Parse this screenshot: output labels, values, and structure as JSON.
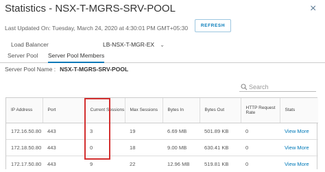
{
  "dialog": {
    "title": "Statistics - NSX-T-MGRS-SRV-POOL",
    "close_glyph": "×",
    "last_updated": "Last Updated On: Tuesday, March 24, 2020 at 4:30:01 PM GMT+05:30",
    "refresh_label": "REFRESH"
  },
  "load_balancer": {
    "label": "Load Balancer",
    "value": "LB-NSX-T-MGR-EX",
    "chevron": "⌄"
  },
  "tabs": [
    {
      "label": "Server Pool",
      "active": false
    },
    {
      "label": "Server Pool Members",
      "active": true
    }
  ],
  "server_pool": {
    "label": "Server Pool Name :",
    "value": "NSX-T-MGRS-SRV-POOL"
  },
  "search": {
    "placeholder": "Search"
  },
  "table": {
    "headers": [
      "IP Address",
      "Port",
      "Current Sessions",
      "Max Sessions",
      "Bytes In",
      "Bytes Out",
      "HTTP Request Rate",
      "Stats"
    ],
    "rows": [
      [
        "172.16.50.80",
        "443",
        "3",
        "19",
        "6.69 MB",
        "501.89 KB",
        "0",
        "View More"
      ],
      [
        "172.18.50.80",
        "443",
        "0",
        "18",
        "9.00 MB",
        "630.41 KB",
        "0",
        "View More"
      ],
      [
        "172.17.50.80",
        "443",
        "9",
        "22",
        "12.96 MB",
        "519.81 KB",
        "0",
        "View More"
      ]
    ]
  },
  "colors": {
    "accent": "#0079b8",
    "highlight": "#d32f2f"
  }
}
